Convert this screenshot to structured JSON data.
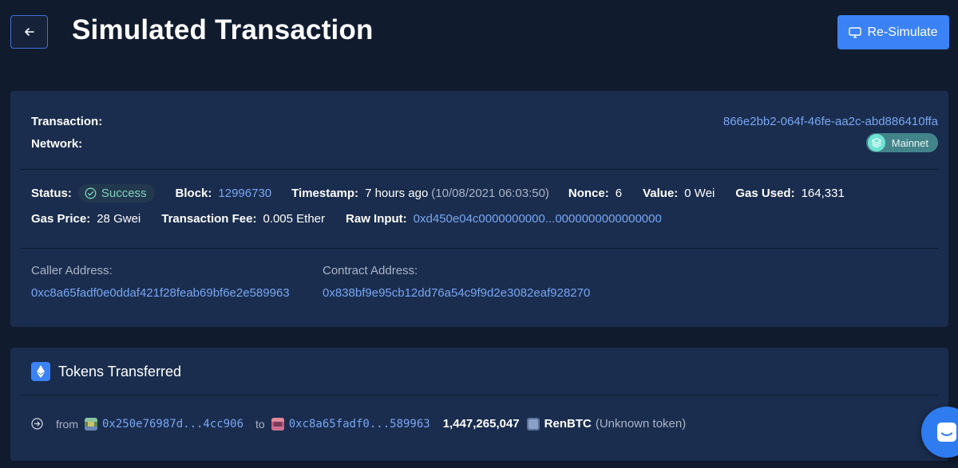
{
  "header": {
    "title": "Simulated Transaction",
    "resimulate_label": "Re-Simulate"
  },
  "transaction": {
    "transaction_label": "Transaction:",
    "transaction_id": "866e2bb2-064f-46fe-aa2c-abd886410ffa",
    "network_label": "Network:",
    "network_value": "Mainnet",
    "status_label": "Status:",
    "status_value": "Success",
    "block_label": "Block:",
    "block_value": "12996730",
    "timestamp_label": "Timestamp:",
    "timestamp_relative": "7 hours ago",
    "timestamp_absolute": "(10/08/2021 06:03:50)",
    "nonce_label": "Nonce:",
    "nonce_value": "6",
    "value_label": "Value:",
    "value_value": "0 Wei",
    "gas_used_label": "Gas Used:",
    "gas_used_value": "164,331",
    "gas_price_label": "Gas Price:",
    "gas_price_value": "28 Gwei",
    "fee_label": "Transaction Fee:",
    "fee_value": "0.005 Ether",
    "raw_input_label": "Raw Input:",
    "raw_input_value": "0xd450e04c0000000000...0000000000000000",
    "caller_label": "Caller Address:",
    "caller_value": "0xc8a65fadf0e0ddaf421f28feab69bf6e2e589963",
    "contract_label": "Contract Address:",
    "contract_value": "0x838bf9e95cb12dd76a54c9f9d2e3082eaf928270"
  },
  "tokens": {
    "title": "Tokens Transferred",
    "transfers": [
      {
        "from_label": "from",
        "from_address": "0x250e76987d...4cc906",
        "to_label": "to",
        "to_address": "0xc8a65fadf0...589963",
        "amount": "1,447,265,047",
        "token_name": "RenBTC",
        "token_note": "(Unknown token)"
      }
    ]
  },
  "colors": {
    "background": "#101b2e",
    "card": "#1a2d4e",
    "accent": "#3b82f6",
    "link": "#79a6f2",
    "success": "#7fd3bd",
    "network_badge": "#43848a"
  },
  "icons": {
    "back": "arrow-left-icon",
    "resimulate": "monitor-play-icon",
    "status": "check-circle-icon",
    "network": "layers-icon",
    "tokens": "ethereum-icon",
    "transfer": "arrow-right-circle-icon",
    "chat": "chat-smile-icon"
  }
}
